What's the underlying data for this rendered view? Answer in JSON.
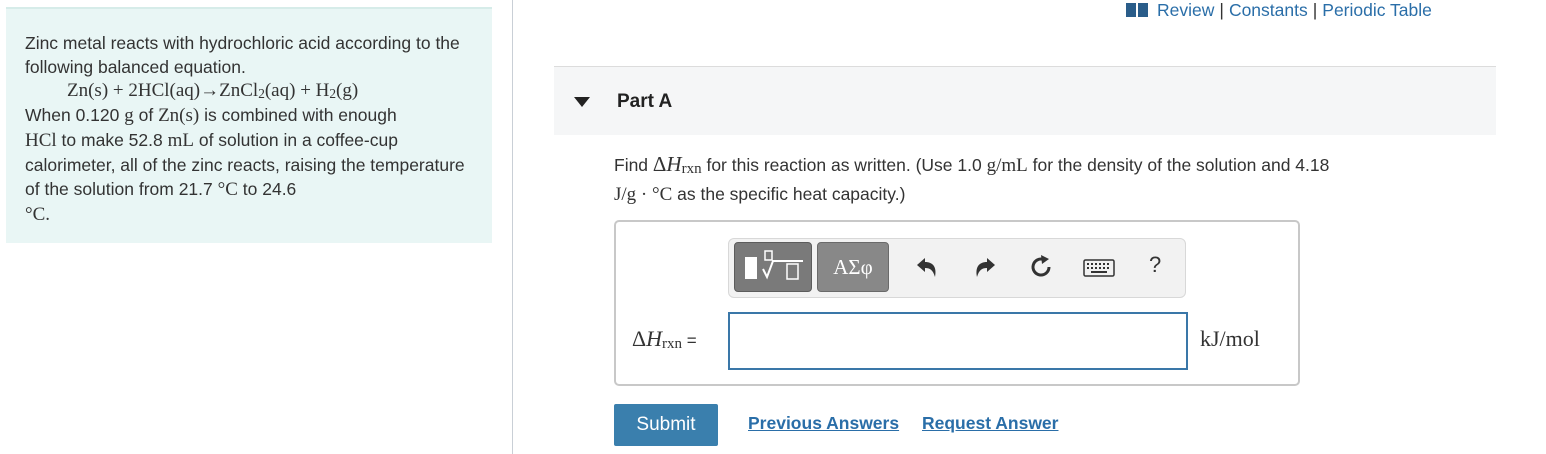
{
  "problem": {
    "intro": "Zinc metal reacts with hydrochloric acid according to the following balanced equation.",
    "equation": {
      "r1": "Zn(s) + 2HCl(aq)",
      "arrow": "→",
      "p1a": "ZnCl",
      "p1sub": "2",
      "p1b": "(aq) + H",
      "p2sub": "2",
      "p2b": "(g)"
    },
    "t_when": "When 0.120 ",
    "t_g": "g",
    "t_of": " of ",
    "t_zn": "Zn(s)",
    "t_enough": " is combined with enough",
    "t_hcl": "HCl",
    "t_make": " to make 52.8 ",
    "t_ml": "mL",
    "t_rest": " of solution in a coffee-cup calorimeter, all of the zinc reacts, raising the temperature of the solution from 21.7 ",
    "t_deg1": "°C",
    "t_to": " to 24.6",
    "t_deg2": "°C."
  },
  "top_links": {
    "review": "Review",
    "sep": "|",
    "constants": "Constants",
    "periodic": "Periodic Table"
  },
  "part": {
    "title": "Part A"
  },
  "question": {
    "q1": "Find ",
    "q_delta": "Δ",
    "q_H": "H",
    "q_sub": "rxn",
    "q2": " for this reaction as written. (Use 1.0 ",
    "q_gml": "g/mL",
    "q3": " for the density of the solution and 4.18",
    "q_unit": "J/g · °C",
    "q4": " as the specific heat capacity.)"
  },
  "answer": {
    "symbols_label": "ΑΣφ",
    "help_label": "?",
    "dh_delta": "Δ",
    "dh_H": "H",
    "dh_sub": "rxn",
    "dh_eq": " =",
    "input_value": "",
    "unit": "kJ/mol"
  },
  "actions": {
    "submit": "Submit",
    "previous": "Previous Answers",
    "request": "Request Answer"
  },
  "colors": {
    "panel_bg": "#e9f6f5",
    "link": "#2a6ea8",
    "submit": "#3a7fad"
  }
}
